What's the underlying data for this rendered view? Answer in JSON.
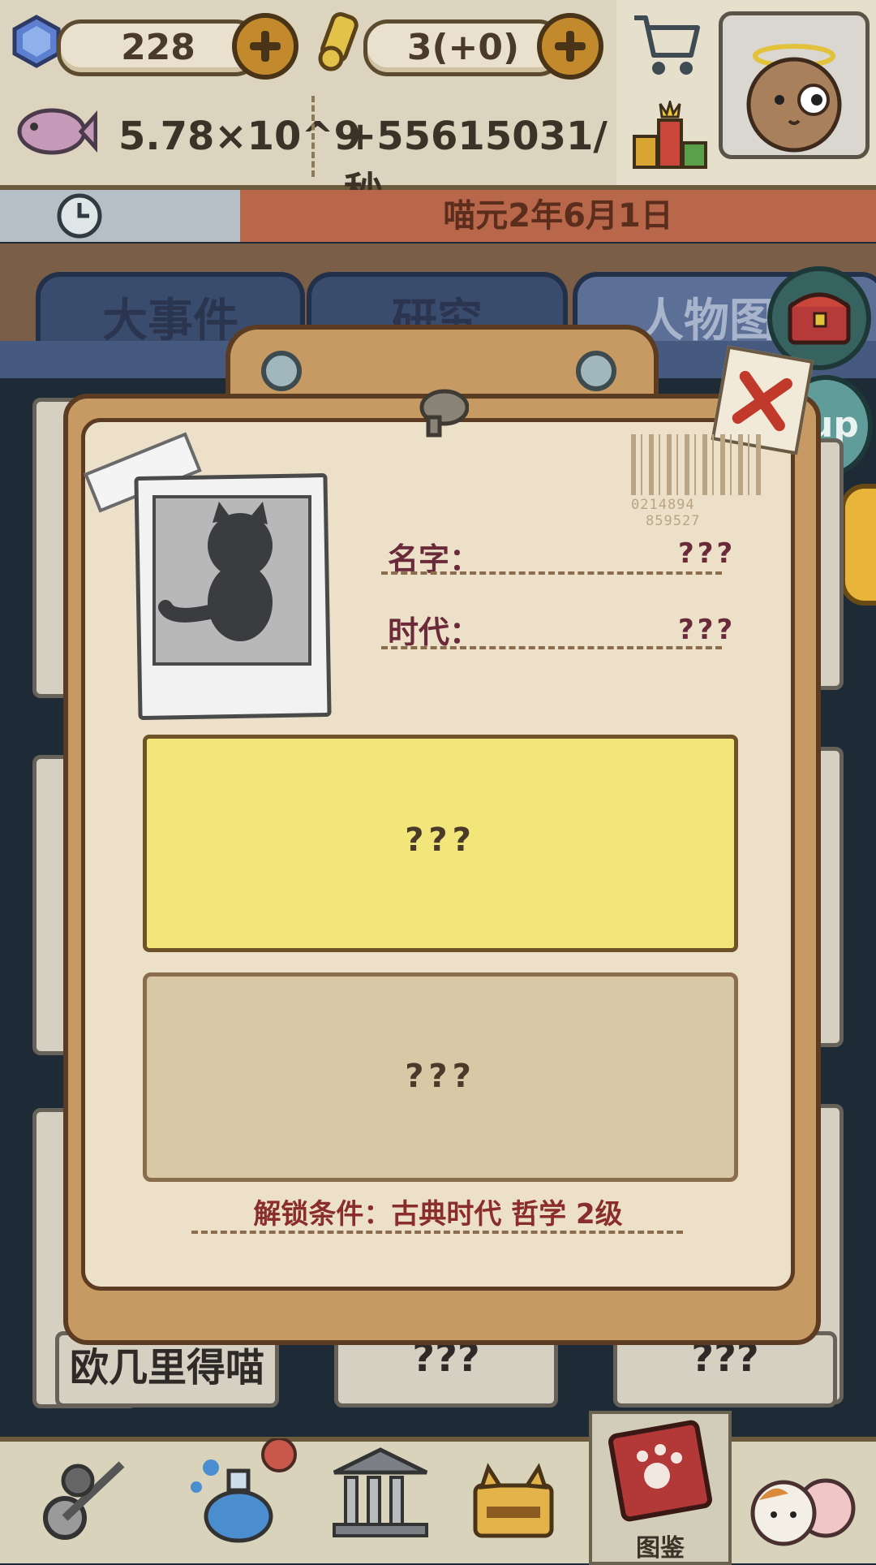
{
  "resources": {
    "gems": "228",
    "scrolls": "3(+0)",
    "fish_total": "5.78×10^9",
    "fish_rate": "+55615031/秒"
  },
  "date": {
    "text": "喵元2年6月1日"
  },
  "tabs": [
    {
      "label": "大事件"
    },
    {
      "label": "研究"
    },
    {
      "label": "人物图鉴"
    }
  ],
  "side_buttons": {
    "up_label": "up"
  },
  "background_cards": [
    {
      "label": "欧几里得喵"
    },
    {
      "label": "???"
    },
    {
      "label": "???"
    }
  ],
  "dossier": {
    "barcode_left": "0214894",
    "barcode_right": "859527",
    "name_label": "名字：",
    "name_value": "???",
    "era_label": "时代：",
    "era_value": "???",
    "description": "???",
    "detail": "???",
    "unlock_condition": "解锁条件：古典时代 哲学 2级"
  },
  "bottom_nav": {
    "active_label": "图鉴"
  },
  "colors": {
    "background": "#1f2a37",
    "board": "#c89a63",
    "paper": "#ece1c8",
    "yellow_box": "#f2e57a",
    "date_bar": "#b9674a",
    "accent_text": "#6a2a3a"
  }
}
